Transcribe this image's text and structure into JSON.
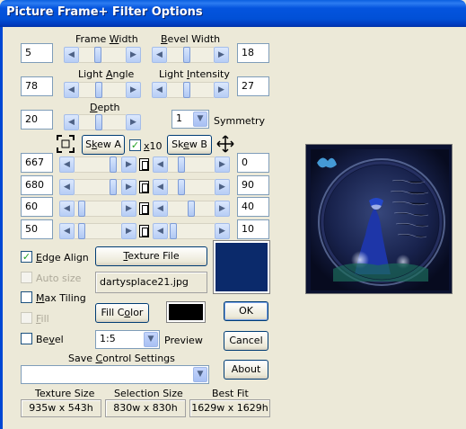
{
  "window": {
    "title": "Picture Frame+ Filter Options"
  },
  "labels": {
    "frame_width": "Frame Width",
    "bevel_width": "Bevel Width",
    "light_angle": "Light Angle",
    "light_intensity": "Light Intensity",
    "depth": "Depth",
    "symmetry": "Symmetry",
    "x10": "x10",
    "save_control_settings": "Save Control Settings",
    "preview": "Preview",
    "texture_size": "Texture Size",
    "selection_size": "Selection Size",
    "best_fit": "Best Fit"
  },
  "values": {
    "frame_width": "5",
    "bevel_width": "18",
    "light_angle": "78",
    "light_intensity": "27",
    "depth": "20",
    "symmetry": "1",
    "left_1": "667",
    "left_2": "680",
    "left_3": "60",
    "left_4": "50",
    "right_1": "0",
    "right_2": "90",
    "right_3": "40",
    "right_4": "10",
    "texture_filename": "dartysplace21.jpg",
    "bevel_ratio": "1:5",
    "save_settings": "",
    "texture_size": "935w x 543h",
    "selection_size": "830w x 830h",
    "best_fit": "1629w x 1629h"
  },
  "buttons": {
    "skew_a": "Skew A",
    "skew_b": "Skew B",
    "texture_file": "Texture File",
    "fill_color": "Fill Color",
    "ok": "OK",
    "cancel": "Cancel",
    "about": "About"
  },
  "checkboxes": {
    "x10": {
      "label": "x10",
      "checked": true
    },
    "edge_align": {
      "label": "Edge Align",
      "checked": true
    },
    "auto_size": {
      "label": "Auto size",
      "checked": false,
      "disabled": true
    },
    "max_tiling": {
      "label": "Max Tiling",
      "checked": false
    },
    "fill": {
      "label": "Fill",
      "checked": false,
      "disabled": true
    },
    "bevel": {
      "label": "Bevel",
      "checked": false
    }
  },
  "sliders": {
    "frame_width": 0.38,
    "bevel_width": 0.42,
    "light_angle": 0.42,
    "light_intensity": 0.42,
    "depth": 0.42,
    "left_1": 0.88,
    "left_2": 0.88,
    "left_3": 0.1,
    "left_4": 0.1,
    "right_1": 0.25,
    "right_2": 0.25,
    "right_3": 0.5,
    "right_4": 0.05
  },
  "colors": {
    "title_bar": "#0050d6",
    "texture_swatch": "#0b2a6b",
    "fill_swatch": "#000000",
    "preview_bg": "#0a1130"
  }
}
